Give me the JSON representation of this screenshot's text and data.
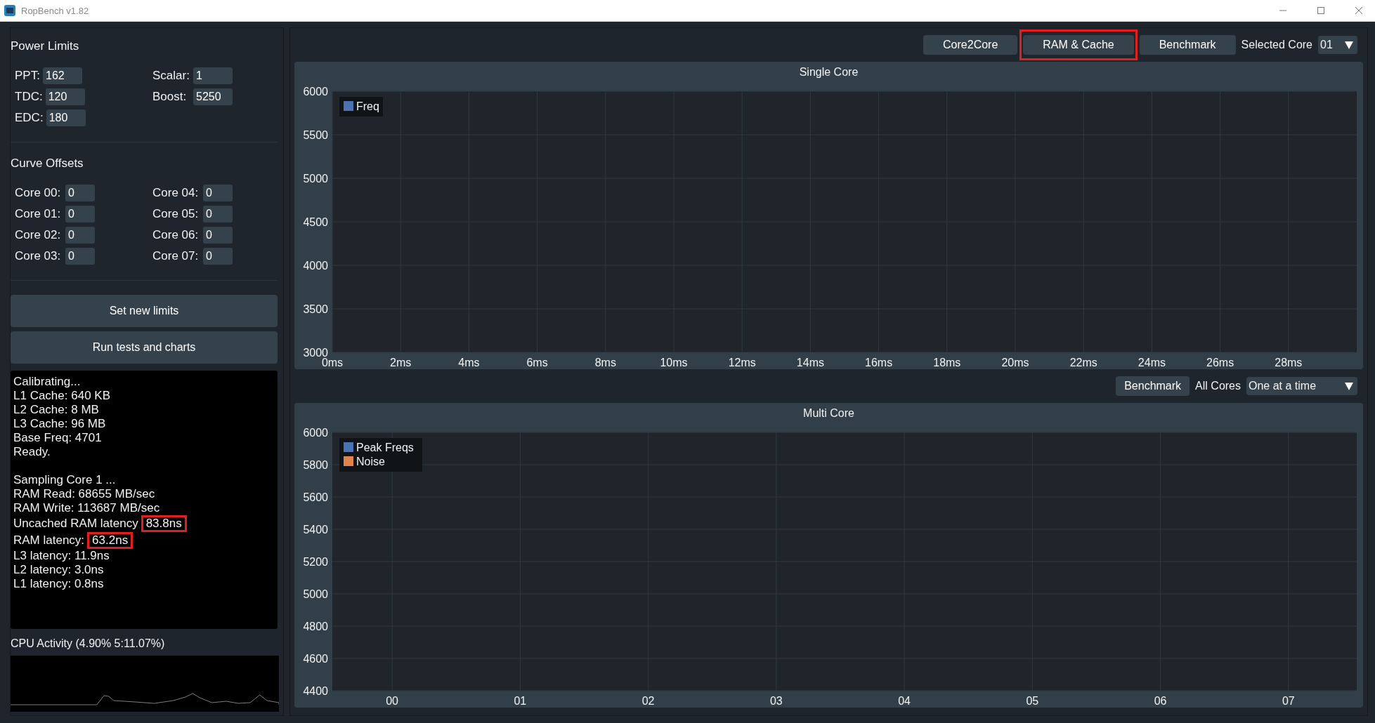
{
  "window": {
    "title": "RopBench v1.82"
  },
  "power_limits": {
    "title": "Power Limits",
    "fields": [
      {
        "label": "PPT:",
        "value": "162"
      },
      {
        "label": "Scalar:",
        "value": "1"
      },
      {
        "label": "TDC:",
        "value": "120"
      },
      {
        "label": "Boost:",
        "value": "5250"
      },
      {
        "label": "EDC:",
        "value": "180"
      }
    ]
  },
  "curve_offsets": {
    "title": "Curve Offsets",
    "fields": [
      {
        "label": "Core 00:",
        "value": "0"
      },
      {
        "label": "Core 04:",
        "value": "0"
      },
      {
        "label": "Core 01:",
        "value": "0"
      },
      {
        "label": "Core 05:",
        "value": "0"
      },
      {
        "label": "Core 02:",
        "value": "0"
      },
      {
        "label": "Core 06:",
        "value": "0"
      },
      {
        "label": "Core 03:",
        "value": "0"
      },
      {
        "label": "Core 07:",
        "value": "0"
      }
    ]
  },
  "actions": [
    "Set new limits",
    "Run tests and charts"
  ],
  "log": [
    {
      "text": "Calibrating..."
    },
    {
      "text": "L1 Cache: 640 KB"
    },
    {
      "text": "L2 Cache: 8 MB"
    },
    {
      "text": "L3 Cache: 96 MB"
    },
    {
      "text": "Base Freq: 4701"
    },
    {
      "text": "Ready."
    },
    {
      "text": "Sampling Core 1 ...",
      "gap_before": true
    },
    {
      "text": "RAM Read: 68655 MB/sec"
    },
    {
      "text": "RAM Write: 113687 MB/sec"
    },
    {
      "text": "Uncached RAM latency",
      "highlight": "83.8ns"
    },
    {
      "text": "RAM latency:",
      "highlight": "63.2ns"
    },
    {
      "text": "L3  latency: 11.9ns"
    },
    {
      "text": "L2  latency: 3.0ns"
    },
    {
      "text": "L1  latency: 0.8ns"
    }
  ],
  "cpu_activity": {
    "label": "CPU Activity (4.90% 5:11.07%)"
  },
  "toolbar": {
    "buttons": [
      {
        "label": "Core2Core",
        "highlighted": false
      },
      {
        "label": "RAM & Cache",
        "highlighted": true
      },
      {
        "label": "Benchmark",
        "highlighted": false
      }
    ],
    "select_label": "Selected Core",
    "select_value": "01"
  },
  "single_core": {
    "chart_data": {
      "type": "line",
      "title": "Single Core",
      "categories": [
        "0ms",
        "2ms",
        "4ms",
        "6ms",
        "8ms",
        "10ms",
        "12ms",
        "14ms",
        "16ms",
        "18ms",
        "20ms",
        "22ms",
        "24ms",
        "26ms",
        "28ms"
      ],
      "series": [
        {
          "name": "Freq",
          "color": "#4a72b4",
          "values": [
            null,
            null,
            null,
            null,
            null,
            null,
            null,
            null,
            null,
            null,
            null,
            null,
            null,
            null,
            null
          ]
        }
      ],
      "ylim": [
        3000,
        6000
      ],
      "grid": true,
      "yticks": [
        3000,
        3500,
        4000,
        4500,
        5000,
        5500,
        6000
      ]
    }
  },
  "benchmark_bar": {
    "button": "Benchmark",
    "label": "All Cores",
    "select_value": "One at a time"
  },
  "multi_core": {
    "chart_data": {
      "type": "bar",
      "title": "Multi Core",
      "categories": [
        "00",
        "01",
        "02",
        "03",
        "04",
        "05",
        "06",
        "07"
      ],
      "series": [
        {
          "name": "Peak Freqs",
          "color": "#4a72b4",
          "values": [
            null,
            null,
            null,
            null,
            null,
            null,
            null,
            null
          ]
        },
        {
          "name": "Noise",
          "color": "#e0844e",
          "values": [
            null,
            null,
            null,
            null,
            null,
            null,
            null,
            null
          ]
        }
      ],
      "ylim": [
        4400,
        6000
      ],
      "grid": true,
      "yticks": [
        4400,
        4600,
        4800,
        5000,
        5200,
        5400,
        5600,
        5800,
        6000
      ]
    }
  }
}
